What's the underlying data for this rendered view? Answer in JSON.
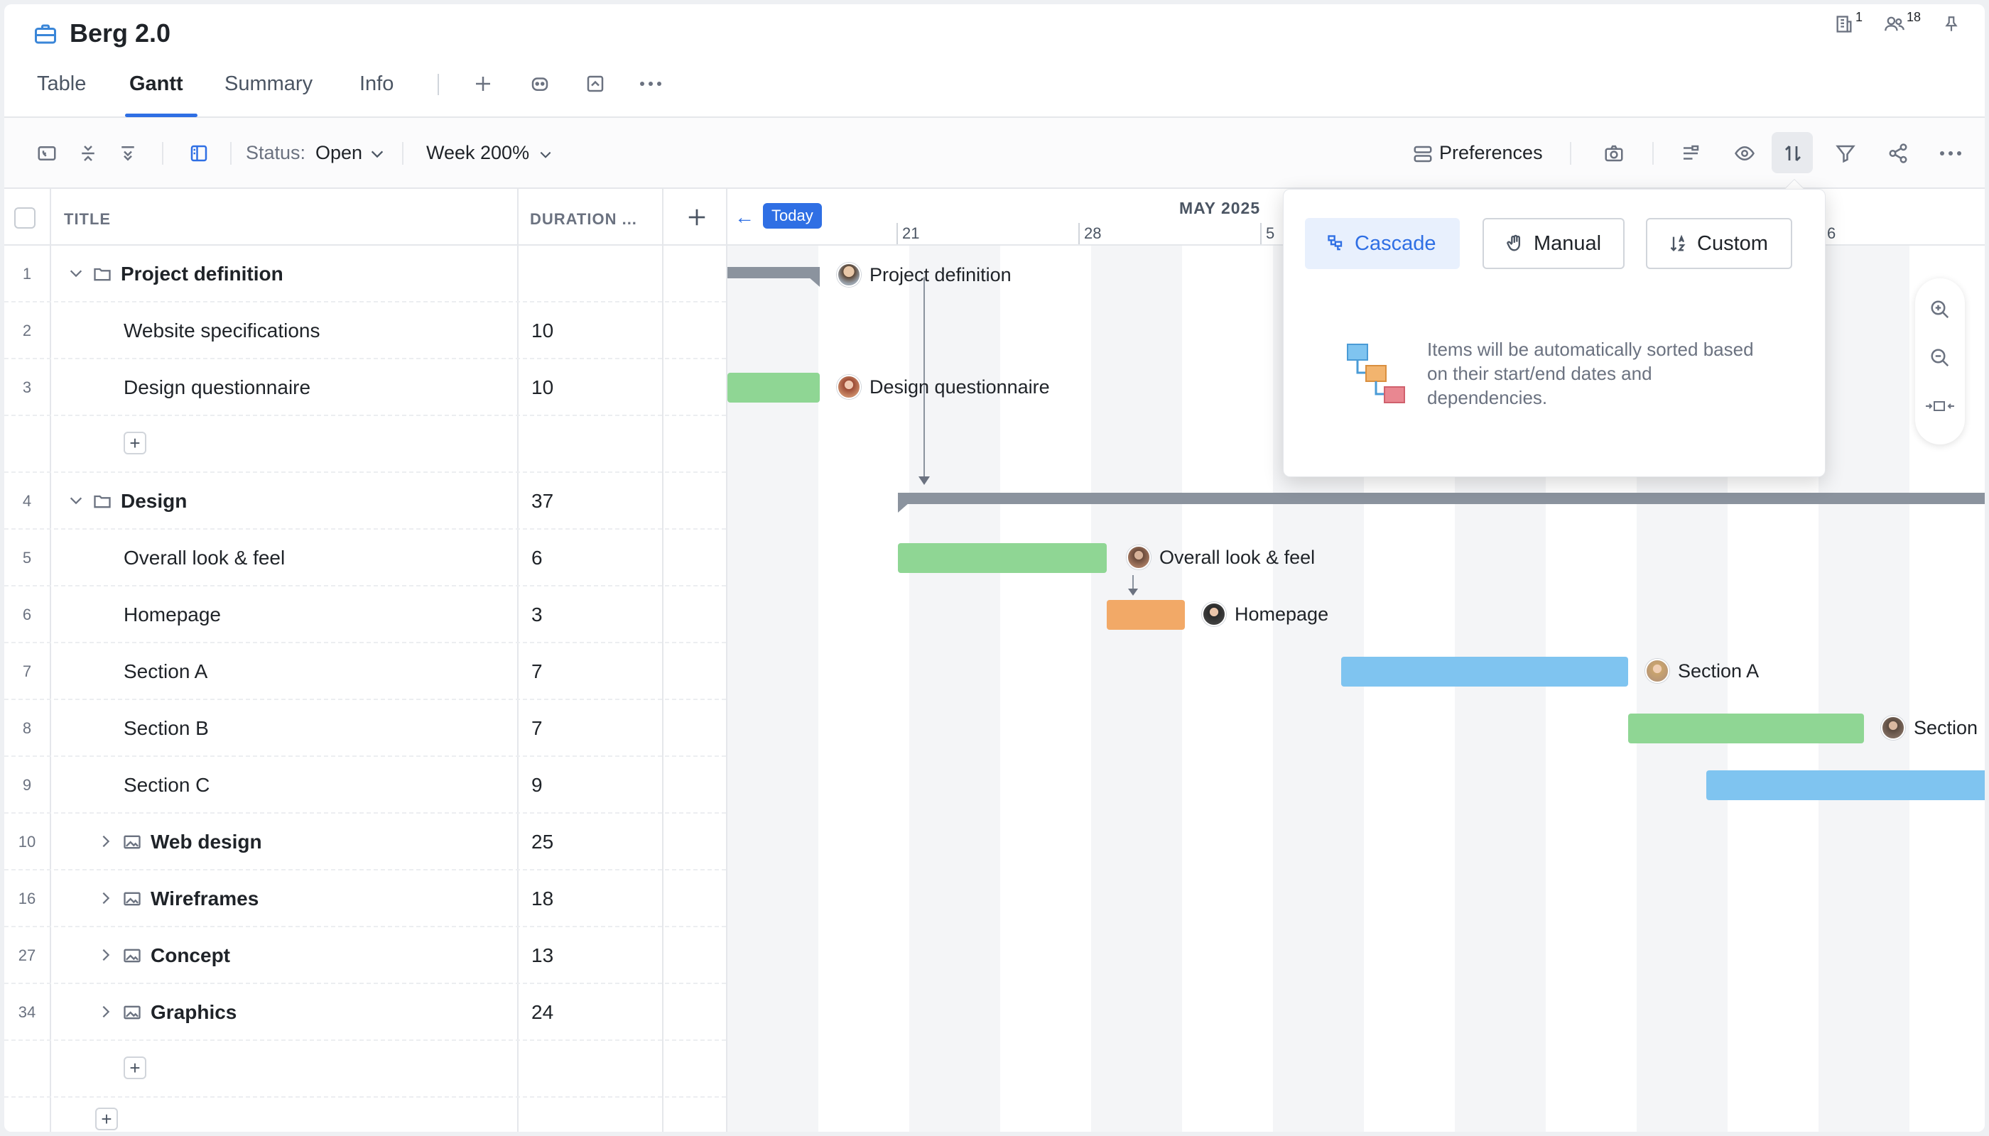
{
  "app": {
    "title": "Berg 2.0",
    "docs_count": "1",
    "users_count": "18"
  },
  "tabs": [
    {
      "label": "Table"
    },
    {
      "label": "Gantt"
    },
    {
      "label": "Summary"
    },
    {
      "label": "Info"
    }
  ],
  "toolbar": {
    "status_label": "Status:",
    "status_value": "Open",
    "zoom_value": "Week 200%",
    "preferences_label": "Preferences"
  },
  "grid": {
    "header_title": "TITLE",
    "header_duration": "DURATION ...",
    "rows": [
      {
        "num": "1",
        "title": "Project definition",
        "duration": ""
      },
      {
        "num": "2",
        "title": "Website specifications",
        "duration": "10"
      },
      {
        "num": "3",
        "title": "Design questionnaire",
        "duration": "10"
      },
      {
        "num": "4",
        "title": "Design",
        "duration": "37"
      },
      {
        "num": "5",
        "title": "Overall look & feel",
        "duration": "6"
      },
      {
        "num": "6",
        "title": "Homepage",
        "duration": "3"
      },
      {
        "num": "7",
        "title": "Section A",
        "duration": "7"
      },
      {
        "num": "8",
        "title": "Section B",
        "duration": "7"
      },
      {
        "num": "9",
        "title": "Section C",
        "duration": "9"
      },
      {
        "num": "10",
        "title": "Web design",
        "duration": "25"
      },
      {
        "num": "16",
        "title": "Wireframes",
        "duration": "18"
      },
      {
        "num": "27",
        "title": "Concept",
        "duration": "13"
      },
      {
        "num": "34",
        "title": "Graphics",
        "duration": "24"
      }
    ]
  },
  "gantt": {
    "today_label": "Today",
    "month_label": "MAY 2025",
    "days": [
      "21",
      "28",
      "5",
      "6"
    ],
    "bar_labels": {
      "project_definition": "Project definition",
      "design_questionnaire": "Design questionnaire",
      "overall_look": "Overall look & feel",
      "homepage": "Homepage",
      "section_a": "Section A",
      "section_b": "Section I"
    },
    "colors": {
      "green": "#8fd694",
      "orange": "#f2a967",
      "blue": "#7fc4f0",
      "summary": "#8b939e",
      "accent": "#2f6fe4"
    }
  },
  "sort_popover": {
    "cascade_label": "Cascade",
    "manual_label": "Manual",
    "custom_label": "Custom",
    "description": "Items will be automatically sorted based on their start/end dates and dependencies."
  }
}
